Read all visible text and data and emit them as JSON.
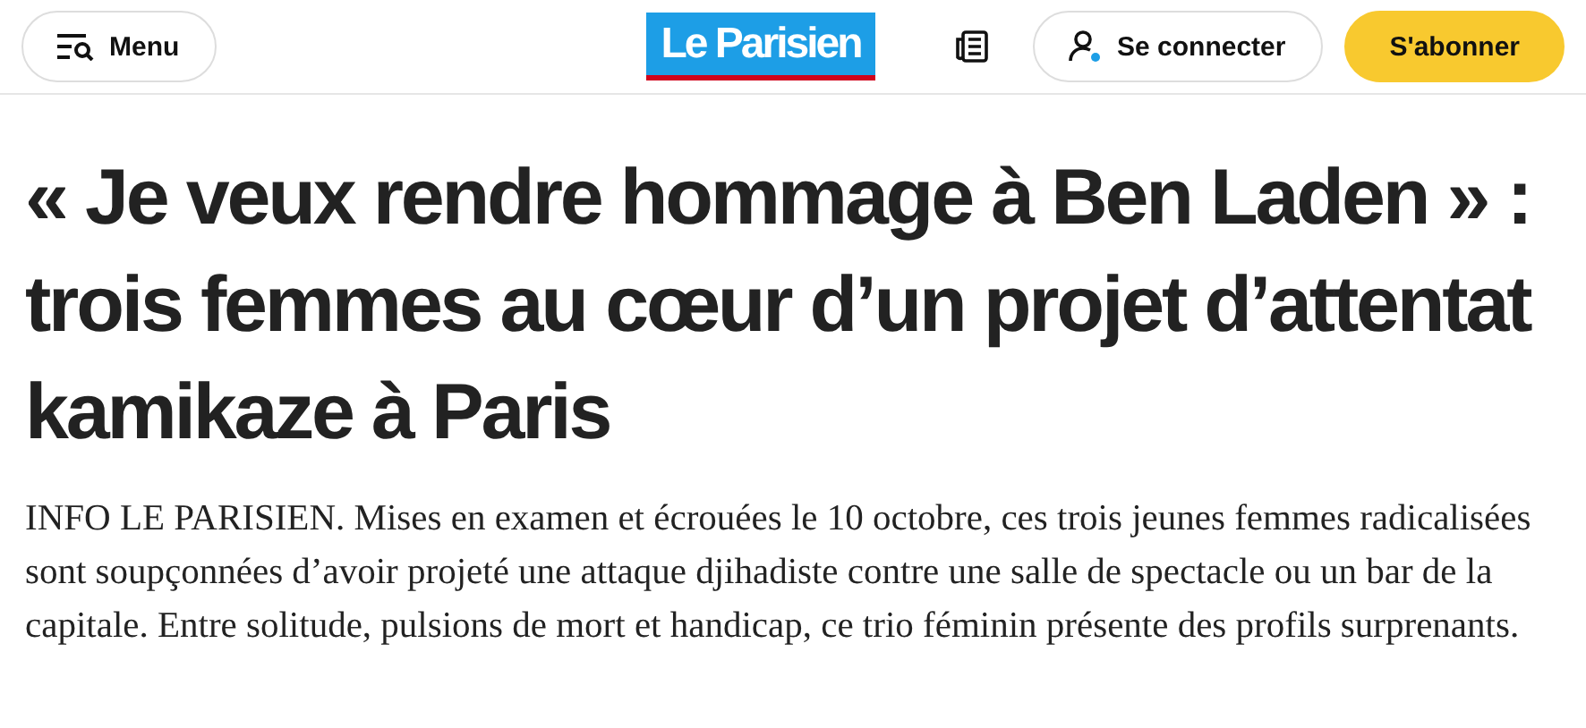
{
  "header": {
    "menu_button": "Menu",
    "logo": "Le Parisien",
    "login_button": "Se connecter",
    "subscribe_button": "S'abonner"
  },
  "article": {
    "headline": "« Je veux rendre hommage à Ben Laden » : trois femmes au cœur d’un projet d’attentat kamikaze à Paris",
    "lead": "INFO LE PARISIEN. Mises en examen et écrouées le 10 octobre, ces trois jeunes femmes radicalisées sont soupçonnées d’avoir projeté une attaque djihadiste contre une salle de spectacle ou un bar de la capitale. Entre solitude, pulsions de mort et handicap, ce trio féminin présente des profils surprenants."
  }
}
